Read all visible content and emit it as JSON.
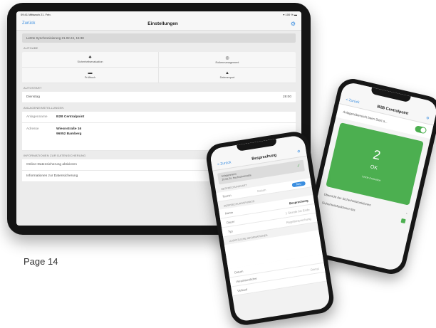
{
  "tablet": {
    "status_time": "09:41  Mittwoch 21. Feb.",
    "status_right": "▾ 100 % ▬",
    "nav_back": "Zurück",
    "nav_title": "Einstellungen",
    "info_box": "Letzte Synchronisierung 21.02.24, 15:38",
    "sections": {
      "tasks": "AUFGABE",
      "auto": "AUTOSTART",
      "system": "ANLAGENEINSTELLUNGEN",
      "info": "INFORMATIONEN ZUR DATENSICHERUNG"
    },
    "tasks": [
      {
        "icon": "♣",
        "label": "Sicherheitsevaluation"
      },
      {
        "icon": "◎",
        "label": "Rollenmanagement"
      },
      {
        "icon": "▬",
        "label": "Prüfbuch"
      },
      {
        "icon": "▲",
        "label": "Datenexport"
      }
    ],
    "autostart": {
      "day": "Dienstag",
      "time": "28:00"
    },
    "system": {
      "name_label": "Anlagenname",
      "name_value": "B2B Centralpoint",
      "address_label": "Adresse",
      "address_line1": "Wiesnstraße 16",
      "address_line2": "96052 Bamberg"
    },
    "info_rows": [
      "Online-Datensicherung aktivieren",
      "Informationen zur Datensicherung"
    ]
  },
  "page_label": "Page 14",
  "phone_right": {
    "nav_back": "< Zurück",
    "nav_title": "B2B Centralpoint",
    "toggle_label": "Anlagenübersicht beim Start a...",
    "count": "2",
    "status": "OK",
    "status_small": "Letzte Evaluation",
    "line1": "Übersicht der Sicherheitsfunktionen",
    "line2": "Sicherheitsfunktionen bis"
  },
  "phone_middle": {
    "nav_back": "< Zurück",
    "nav_title": "Besprechung",
    "info_line1": "Anlagenname",
    "info_line2": "20.02.24, Hochschulstraße",
    "sec1": "BESPRECHUNGSART",
    "row1_label": "Termin",
    "row1_value": "Datum",
    "row1_btn": "Neu",
    "sec2": "BESPRECHUNGSPUNKTE",
    "rows": [
      {
        "label": "Name",
        "value": "Besprechung"
      },
      {
        "label": "Dauer",
        "value": "1 Stunde bis Ende"
      },
      {
        "label": "Typ",
        "value": "Regelbesprechung"
      }
    ],
    "sec3": "ZUSÄTZLICHE INFORMATIONEN",
    "bottom_rows": [
      {
        "label": "Datum",
        "value": ""
      },
      {
        "label": "Verantwortlicher",
        "value": "Dienst"
      },
      {
        "label": "Verkauf",
        "value": ""
      }
    ]
  }
}
